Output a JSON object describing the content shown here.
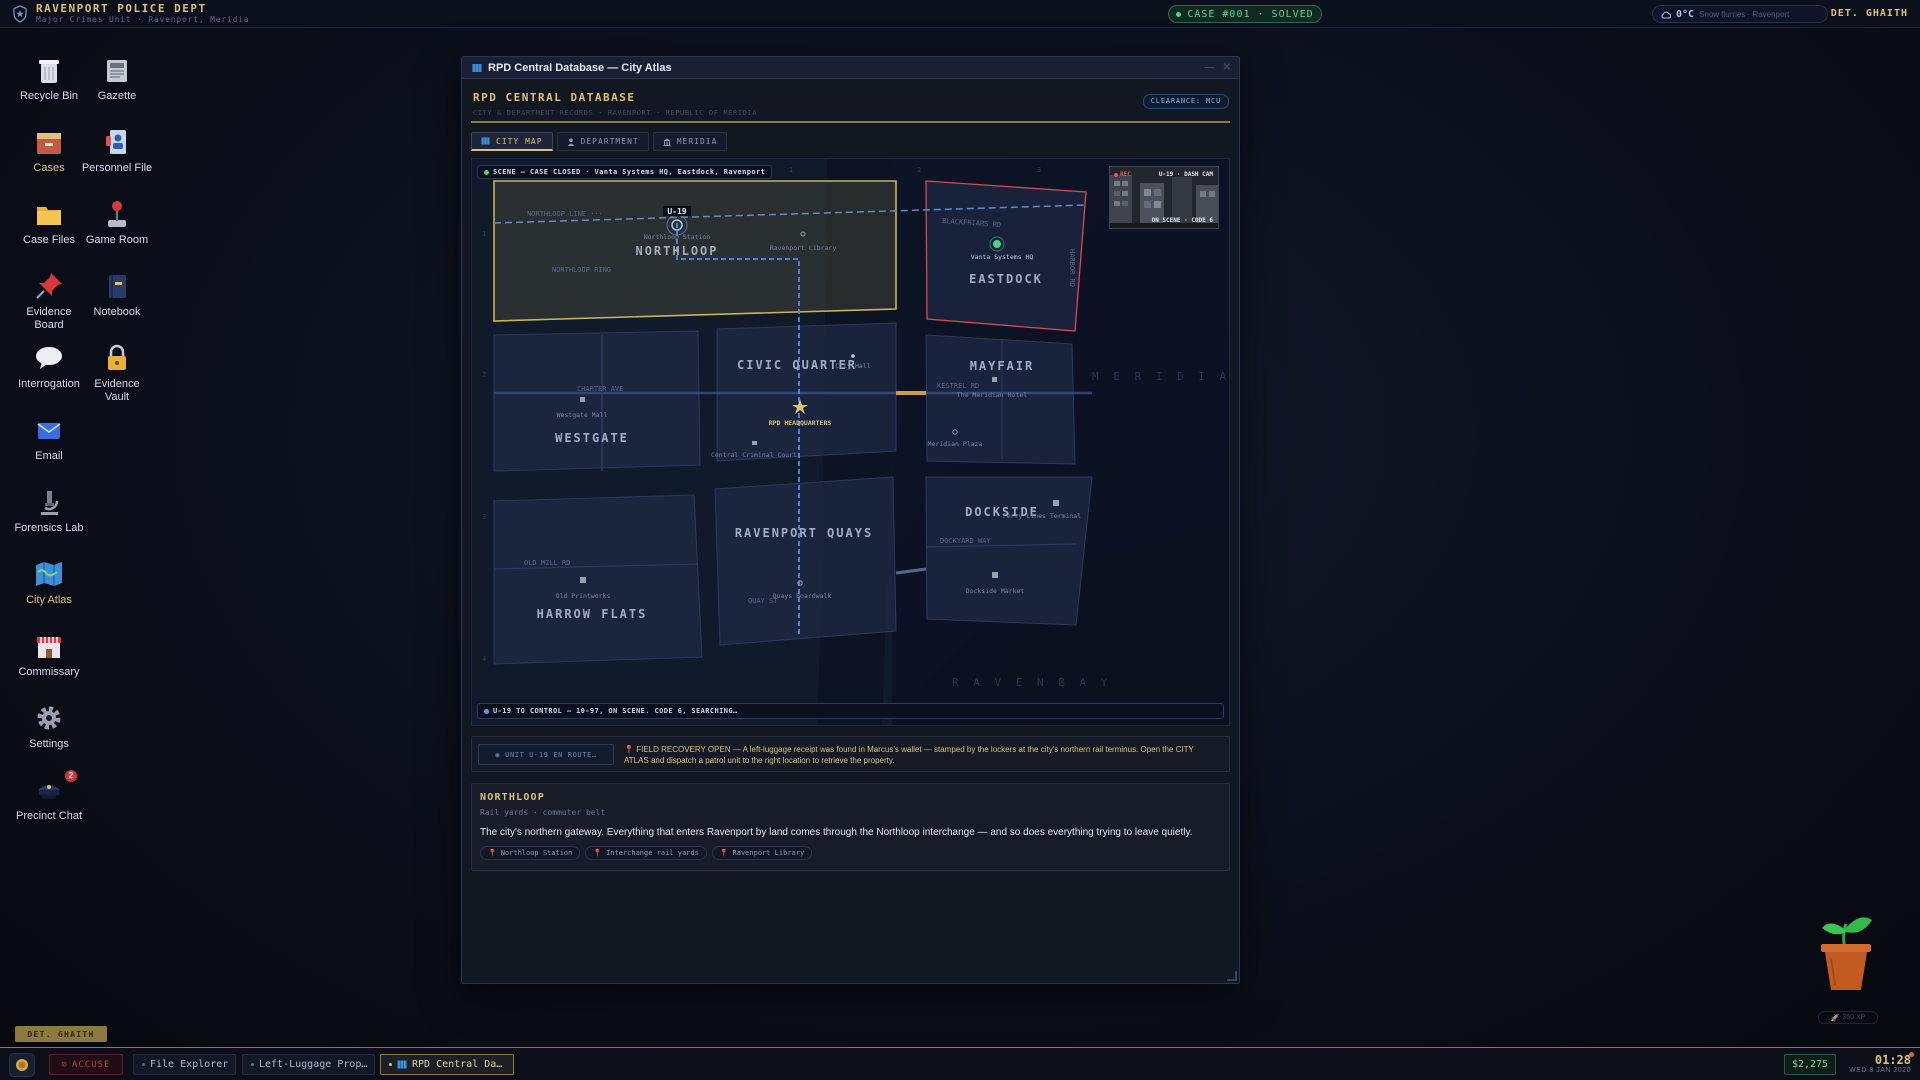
{
  "topbar": {
    "title": "RAVENPORT POLICE DEPT",
    "subtitle": "Major Crimes Unit · Ravenport, Meridia",
    "case_status": "CASE #001 · SOLVED",
    "temperature": "0°C",
    "weather": "Snow flurries · Ravenport",
    "user": "DET. GHAITH"
  },
  "desktop": {
    "icons": [
      {
        "label": "Recycle Bin"
      },
      {
        "label": "Gazette"
      },
      {
        "label": "Cases"
      },
      {
        "label": "Personnel File"
      },
      {
        "label": "Case Files"
      },
      {
        "label": "Game Room"
      },
      {
        "label": "Evidence Board"
      },
      {
        "label": "Notebook"
      },
      {
        "label": "Interrogation"
      },
      {
        "label": "Evidence Vault"
      },
      {
        "label": "Email"
      },
      {
        "label": "Forensics Lab"
      },
      {
        "label": "City Atlas"
      },
      {
        "label": "Commissary"
      },
      {
        "label": "Settings"
      },
      {
        "label": "Precinct Chat",
        "badge": "2"
      }
    ],
    "detective_badge": "DET. GHAITH"
  },
  "window": {
    "title": "RPD Central Database — City Atlas",
    "db_title": "RPD CENTRAL DATABASE",
    "db_subtitle": "CITY & DEPARTMENT RECORDS · RAVENPORT · REPUBLIC OF MERIDIA",
    "clearance": "CLEARANCE: MCU",
    "tabs": [
      {
        "label": "CITY MAP",
        "icon": "map-icon",
        "active": true
      },
      {
        "label": "DEPARTMENT",
        "icon": "person-icon",
        "active": false
      },
      {
        "label": "MERIDIA",
        "icon": "building-icon",
        "active": false
      }
    ]
  },
  "map": {
    "scene_badge": "SCENE — CASE CLOSED · Vanta Systems HQ, Eastdock, Ravenport",
    "dashcam_title": "U-19 · DASH CAM",
    "dashcam_rec": "REC",
    "dashcam_status": "ON SCENE · CODE 6",
    "unit_label": "U-19",
    "status_bar": "U-19 TO CONTROL — 10-97, ON SCENE. CODE 6, SEARCHING…",
    "districts": {
      "northloop": "NORTHLOOP",
      "eastdock": "EASTDOCK",
      "civic_quarter": "CIVIC QUARTER",
      "mayfair": "MAYFAIR",
      "westgate": "WESTGATE",
      "ravenport_quays": "RAVENPORT QUAYS",
      "dockside": "DOCKSIDE",
      "harrow_flats": "HARROW FLATS"
    },
    "streets": {
      "northloop_line": "NORTHLOOP LINE ···",
      "northloop_ring": "NORTHLOOP RING",
      "blackfriars": "BLACKFRIARS RD",
      "harbor": "HARBOR RD",
      "charter_ave": "CHARTER AVE",
      "kestrel_rd": "KESTREL RD",
      "old_mill_rd": "OLD MILL RD",
      "dockyard_way": "DOCKYARD WAY",
      "quay_st": "QUAY ST"
    },
    "places": {
      "northloop_station": "Northloop Station",
      "ravenport_library": "Ravenport Library",
      "vanta_hq": "Vanta Systems HQ",
      "city_hall": "City Hall",
      "rpd_hq": "RPD HEADQUARTERS",
      "central_court": "Central Criminal Court",
      "westgate_mall": "Westgate Mall",
      "meridian_hotel": "The Meridian Hotel",
      "meridian_plaza": "Meridian Plaza",
      "ferry_terminal": "Ferry Lines Terminal",
      "dockside_market": "Dockside Market",
      "old_printworks": "Old Printworks",
      "quays_boardwalk": "Quays Boardwalk"
    },
    "water": {
      "sea": "M E R I D I A N   S E A",
      "bay": "R A V E N   B A Y"
    },
    "grid": {
      "cols": [
        "1",
        "2",
        "3"
      ],
      "rows": [
        "1",
        "2",
        "3",
        "4"
      ]
    }
  },
  "notice": {
    "unit_button": "UNIT U-19 EN ROUTE…",
    "text": "FIELD RECOVERY OPEN — A left-luggage receipt was found in Marcus's wallet — stamped by the lockers at the city's northern rail terminus. Open the CITY ATLAS and dispatch a patrol unit to the right location to retrieve the property."
  },
  "info": {
    "title": "NORTHLOOP",
    "subtitle": "Rail yards · commuter belt",
    "description": "The city's northern gateway. Everything that enters Ravenport by land comes through the Northloop interchange — and so does everything trying to leave quietly.",
    "chips": [
      "Northloop Station",
      "Interchange rail yards",
      "Ravenport Library"
    ]
  },
  "plant_label": "350 XP",
  "taskbar": {
    "accuse": "ACCUSE",
    "tasks": [
      {
        "label": "File Explorer",
        "active": false
      },
      {
        "label": "Left-Luggage Prop…",
        "active": false
      },
      {
        "label": "RPD Central Da…",
        "active": true
      }
    ],
    "money": "$2,275",
    "time": "01:28",
    "date": "WED 8 JAN 2020"
  },
  "colors": {
    "accent_gold": "#d9c27a",
    "solved_green": "#5fd59a",
    "route_blue": "#4a82d8",
    "scene_red": "#d24c52",
    "selected_district": "#c9b35a"
  }
}
